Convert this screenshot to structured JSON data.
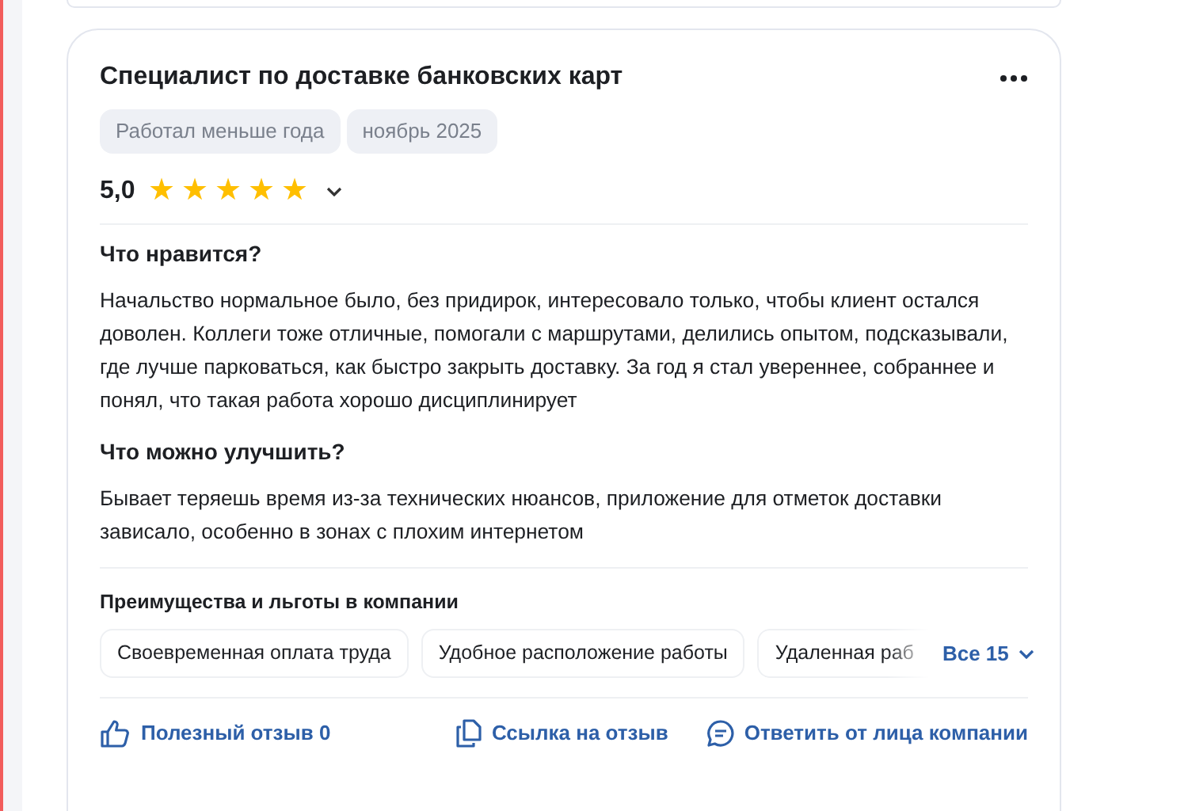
{
  "review": {
    "title": "Специалист по доставке банковских карт",
    "tags": [
      "Работал меньше года",
      "ноябрь 2025"
    ],
    "rating": "5,0",
    "stars": 5,
    "sections": [
      {
        "heading": "Что нравится?",
        "text": "Начальство нормальное было, без придирок, интересовало только, чтобы клиент остался доволен. Коллеги тоже отличные, помогали с маршрутами, делились опытом, подсказывали, где лучше парковаться, как быстро закрыть доставку. За год я стал увереннее, собраннее и понял, что такая работа хорошо дисциплинирует"
      },
      {
        "heading": "Что можно улучшить?",
        "text": "Бывает теряешь время из-за технических нюансов, приложение для отметок доставки зависало, особенно в зонах с плохим интернетом"
      }
    ],
    "benefits_title": "Преимущества и льготы в компании",
    "benefits": [
      "Своевременная оплата труда",
      "Удобное расположение работы",
      "Удаленная раб"
    ],
    "benefits_more": "Все 15",
    "actions": [
      {
        "kind": "like",
        "label": "Полезный отзыв 0"
      },
      {
        "kind": "link",
        "label": "Ссылка на отзыв"
      },
      {
        "kind": "reply",
        "label": "Ответить от лица компании"
      }
    ]
  }
}
